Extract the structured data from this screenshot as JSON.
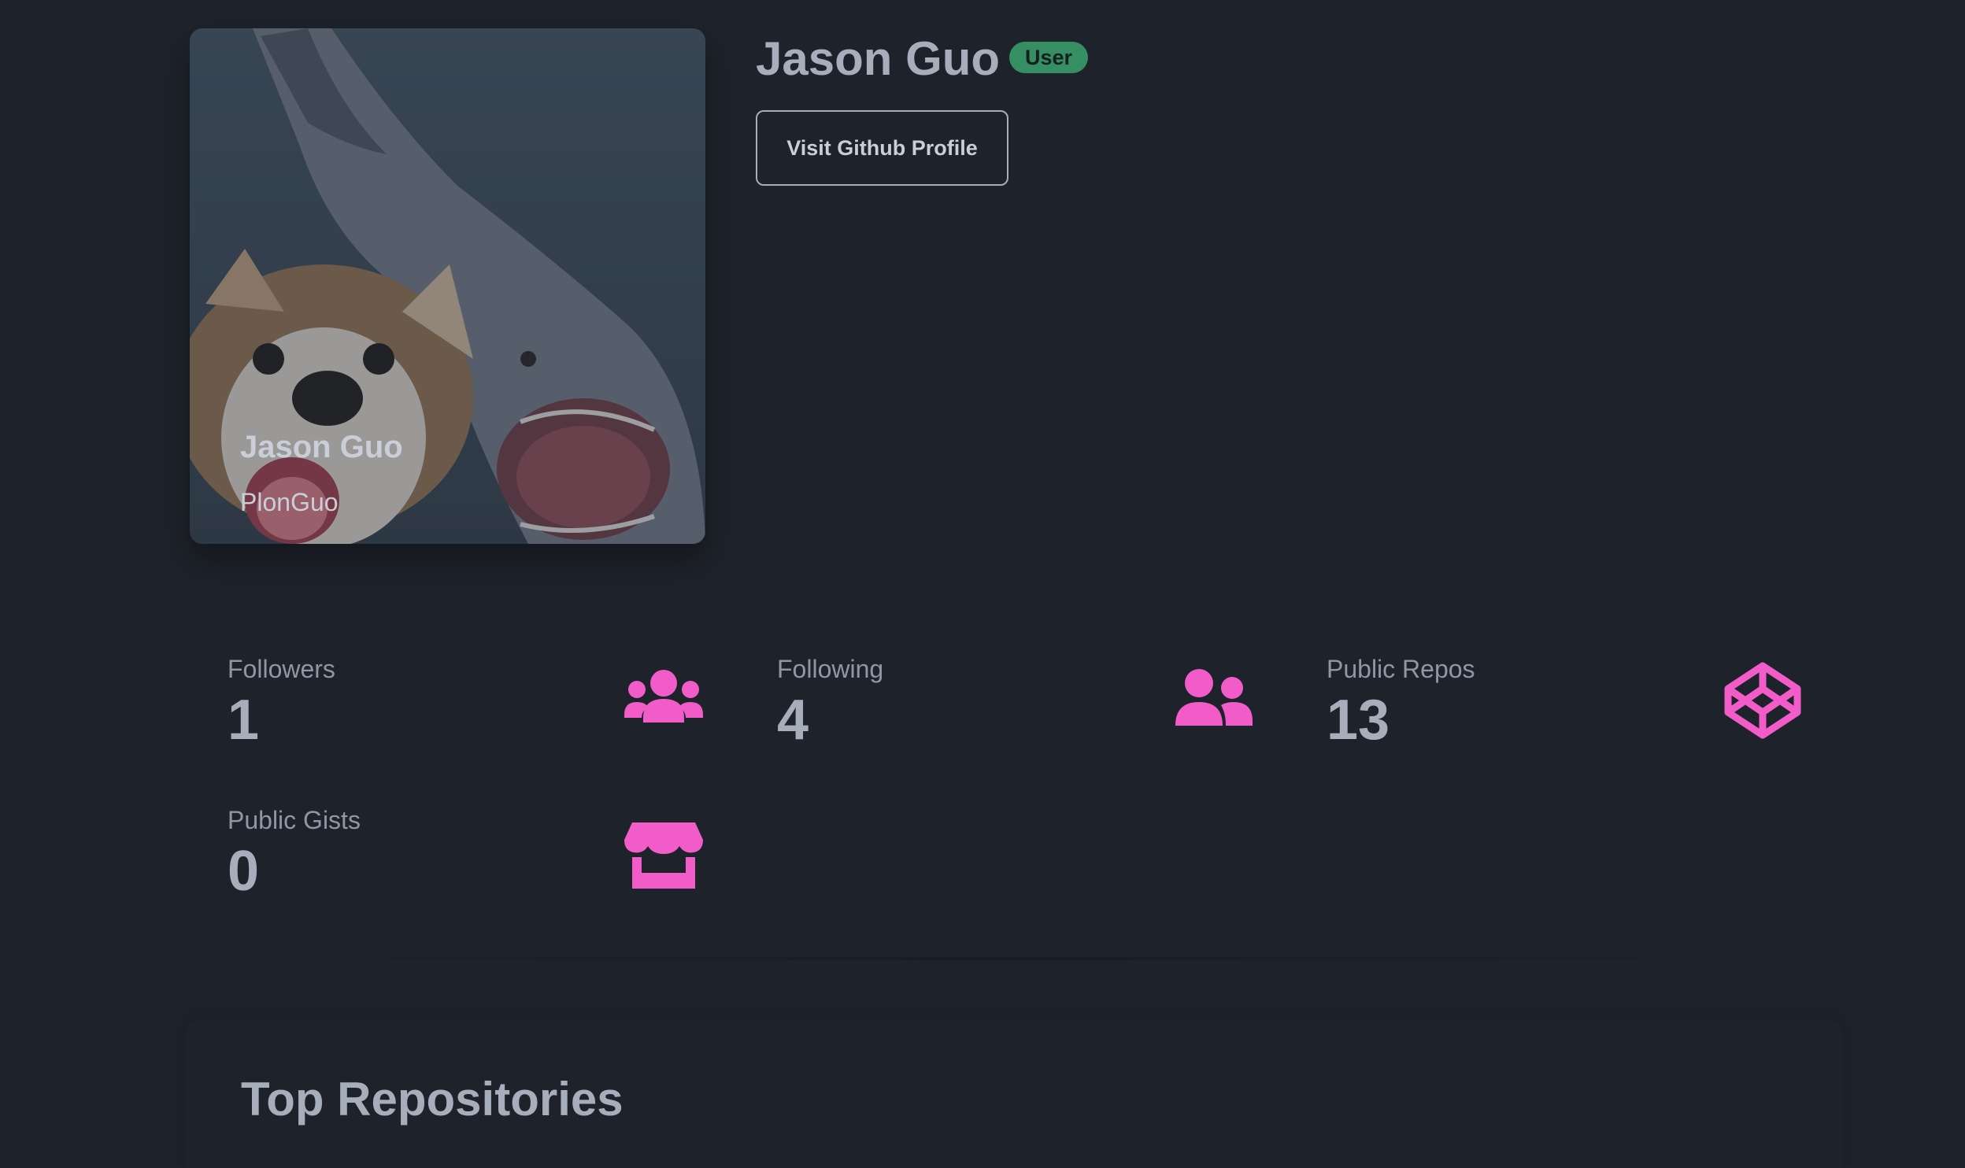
{
  "user": {
    "name": "Jason Guo",
    "login": "PlonGuo",
    "type_badge": "User",
    "visit_label": "Visit Github Profile"
  },
  "stats": [
    {
      "label": "Followers",
      "value": "1",
      "icon": "users-icon"
    },
    {
      "label": "Following",
      "value": "4",
      "icon": "user-friends-icon"
    },
    {
      "label": "Public Repos",
      "value": "13",
      "icon": "codepen-icon"
    },
    {
      "label": "Public Gists",
      "value": "0",
      "icon": "store-icon"
    }
  ],
  "repos": {
    "title": "Top Repositories"
  },
  "colors": {
    "background": "#1e222a",
    "text": "#a6adbb",
    "accent_pink": "#f25cc9",
    "badge_green": "#3aa36c"
  }
}
